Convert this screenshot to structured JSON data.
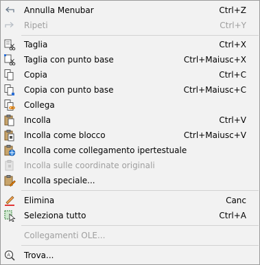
{
  "menu": {
    "items": [
      {
        "label": "Annulla Menubar",
        "shortcut": "Ctrl+Z",
        "disabled": false,
        "icon": "undo-icon"
      },
      {
        "label": "Ripeti",
        "shortcut": "Ctrl+Y",
        "disabled": true,
        "icon": "redo-icon"
      },
      {
        "label": "Taglia",
        "shortcut": "Ctrl+X",
        "disabled": false,
        "icon": "cut-icon"
      },
      {
        "label": "Taglia con punto base",
        "shortcut": "Ctrl+Maiusc+X",
        "disabled": false,
        "icon": "cut-basepoint-icon"
      },
      {
        "label": "Copia",
        "shortcut": "Ctrl+C",
        "disabled": false,
        "icon": "copy-icon"
      },
      {
        "label": "Copia con punto base",
        "shortcut": "Ctrl+Maiusc+C",
        "disabled": false,
        "icon": "copy-basepoint-icon"
      },
      {
        "label": "Collega",
        "shortcut": "",
        "disabled": false,
        "icon": "link-icon"
      },
      {
        "label": "Incolla",
        "shortcut": "Ctrl+V",
        "disabled": false,
        "icon": "paste-icon"
      },
      {
        "label": "Incolla come blocco",
        "shortcut": "Ctrl+Maiusc+V",
        "disabled": false,
        "icon": "paste-block-icon"
      },
      {
        "label": "Incolla come collegamento ipertestuale",
        "shortcut": "",
        "disabled": false,
        "icon": "paste-hyperlink-icon"
      },
      {
        "label": "Incolla sulle coordinate originali",
        "shortcut": "",
        "disabled": true,
        "icon": "paste-original-coords-icon"
      },
      {
        "label": "Incolla speciale...",
        "shortcut": "",
        "disabled": false,
        "icon": "paste-special-icon"
      },
      {
        "label": "Elimina",
        "shortcut": "Canc",
        "disabled": false,
        "icon": "erase-icon"
      },
      {
        "label": "Seleziona tutto",
        "shortcut": "Ctrl+A",
        "disabled": false,
        "icon": "select-all-icon"
      },
      {
        "label": "Collegamenti OLE...",
        "shortcut": "",
        "disabled": true,
        "icon": ""
      },
      {
        "label": "Trova...",
        "shortcut": "",
        "disabled": false,
        "icon": "find-icon"
      }
    ]
  }
}
